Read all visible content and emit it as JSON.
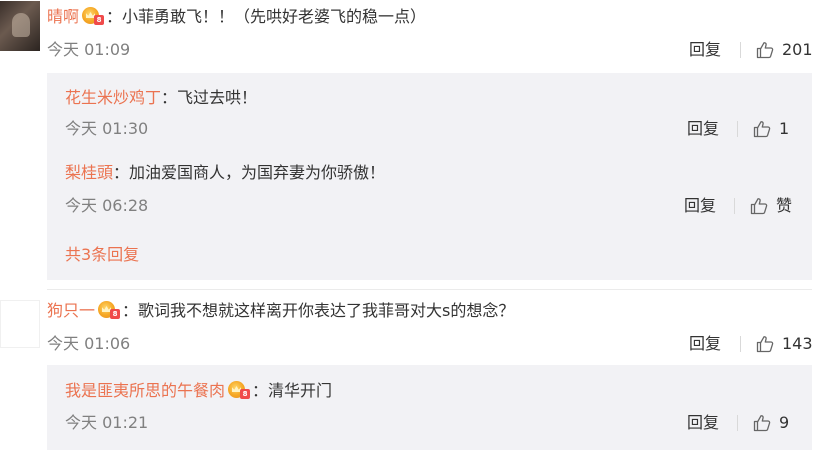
{
  "icons": {
    "like": "thumbs-up-icon",
    "vip": "vip-crown-icon"
  },
  "colors": {
    "username": "#eb7350",
    "reply_bg": "#f2f2f5",
    "muted": "#808080"
  },
  "comments": [
    {
      "username": "晴啊",
      "colon": "：",
      "text": "小菲勇敢飞！！（先哄好老婆飞的稳一点）",
      "time": "今天 01:09",
      "reply_label": "回复",
      "likes": "201",
      "replies": [
        {
          "username": "花生米炒鸡丁",
          "colon": "：",
          "text": "飞过去哄！",
          "time": "今天 01:30",
          "reply_label": "回复",
          "likes": "1"
        },
        {
          "username": "梨桂頭",
          "colon": "：",
          "text": "加油爱国商人，为国弃妻为你骄傲！",
          "time": "今天 06:28",
          "reply_label": "回复",
          "likes": "赞"
        }
      ],
      "more_replies": "共3条回复"
    },
    {
      "username": "狗只一",
      "colon": "：",
      "text": "歌词我不想就这样离开你表达了我菲哥对大s的想念？",
      "time": "今天 01:06",
      "reply_label": "回复",
      "likes": "143",
      "replies": [
        {
          "username": "我是匪夷所思的午餐肉",
          "colon": "：",
          "text": "清华开门",
          "time": "今天 01:21",
          "reply_label": "回复",
          "likes": "9"
        }
      ]
    }
  ]
}
